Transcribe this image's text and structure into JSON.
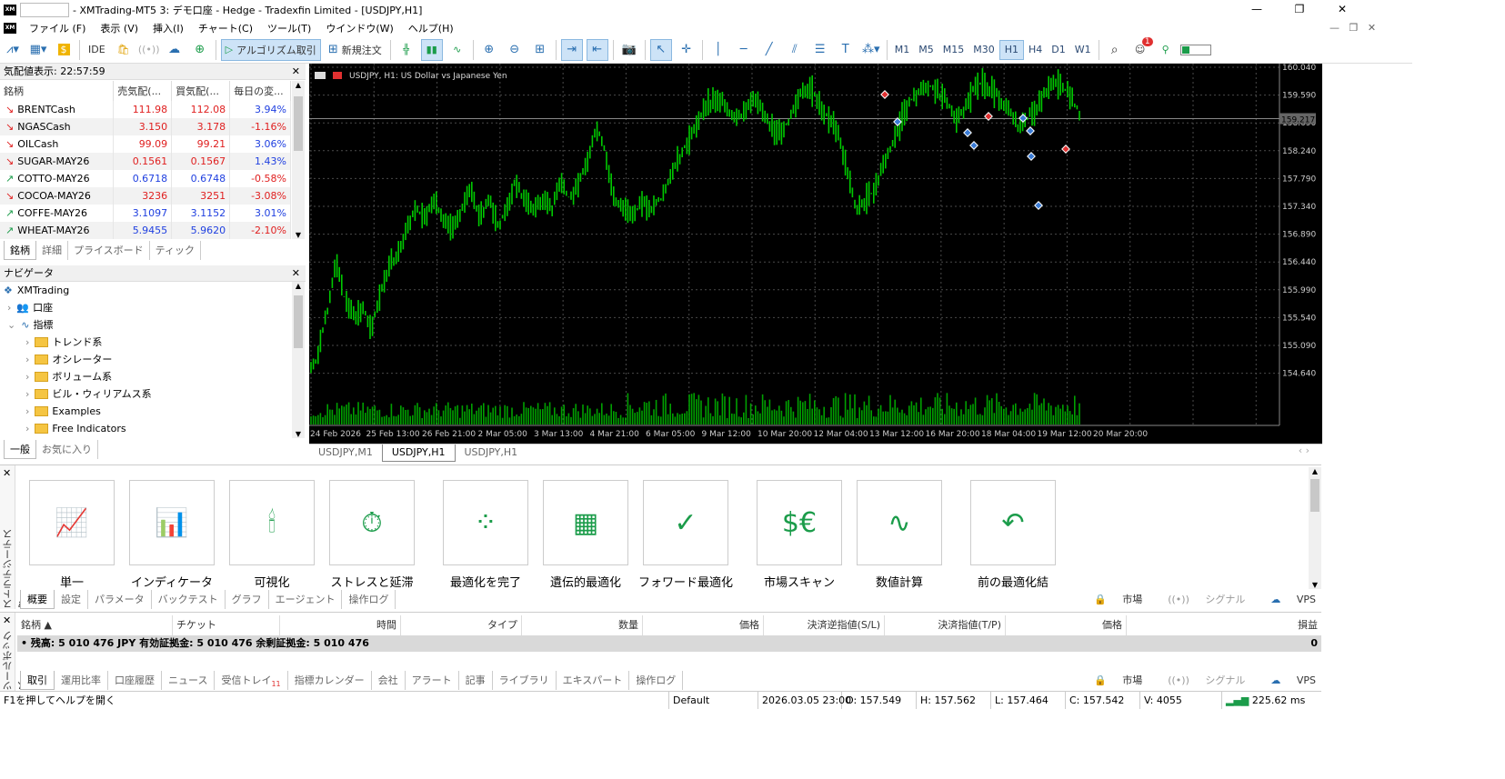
{
  "titlebar": {
    "title": "- XMTrading-MT5 3: デモ口座 - Hedge - Tradexfin Limited - [USDJPY,H1]",
    "minimize": "—",
    "maximize": "❐",
    "close": "✕"
  },
  "menu": [
    "ファイル (F)",
    "表示 (V)",
    "挿入(I)",
    "チャート(C)",
    "ツール(T)",
    "ウインドウ(W)",
    "ヘルプ(H)"
  ],
  "toolbar": {
    "ide": "IDE",
    "algo": "アルゴリズム取引",
    "new_order": "新規注文",
    "timeframes": [
      "M1",
      "M5",
      "M15",
      "M30",
      "H1",
      "H4",
      "D1",
      "W1"
    ],
    "active_tf": "H1",
    "notify_count": "1"
  },
  "market_watch": {
    "title": "気配値表示: 22:57:59",
    "headers": [
      "銘柄",
      "売気配(...",
      "買気配(...",
      "毎日の変..."
    ],
    "rows": [
      {
        "symbol": "BRENTCash",
        "dir": "down",
        "bid": "111.98",
        "ask": "112.08",
        "change": "3.94%",
        "color": "red",
        "chg_color": "blue"
      },
      {
        "symbol": "NGASCash",
        "dir": "down",
        "bid": "3.150",
        "ask": "3.178",
        "change": "-1.16%",
        "color": "red",
        "chg_color": "red"
      },
      {
        "symbol": "OILCash",
        "dir": "down",
        "bid": "99.09",
        "ask": "99.21",
        "change": "3.06%",
        "color": "red",
        "chg_color": "blue"
      },
      {
        "symbol": "SUGAR-MAY26",
        "dir": "down",
        "bid": "0.1561",
        "ask": "0.1567",
        "change": "1.43%",
        "color": "red",
        "chg_color": "blue"
      },
      {
        "symbol": "COTTO-MAY26",
        "dir": "up",
        "bid": "0.6718",
        "ask": "0.6748",
        "change": "-0.58%",
        "color": "blue",
        "chg_color": "red"
      },
      {
        "symbol": "COCOA-MAY26",
        "dir": "down",
        "bid": "3236",
        "ask": "3251",
        "change": "-3.08%",
        "color": "red",
        "chg_color": "red"
      },
      {
        "symbol": "COFFE-MAY26",
        "dir": "up",
        "bid": "3.1097",
        "ask": "3.1152",
        "change": "3.01%",
        "color": "blue",
        "chg_color": "blue"
      },
      {
        "symbol": "WHEAT-MAY26",
        "dir": "up",
        "bid": "5.9455",
        "ask": "5.9620",
        "change": "-2.10%",
        "color": "blue",
        "chg_color": "red"
      }
    ],
    "tabs": [
      "銘柄",
      "詳細",
      "プライスボード",
      "ティック"
    ]
  },
  "navigator": {
    "title": "ナビゲータ",
    "root": "XMTrading",
    "items": [
      "口座",
      "指標"
    ],
    "folders": [
      "トレンド系",
      "オシレーター",
      "ボリューム系",
      "ビル・ウィリアムス系",
      "Examples",
      "Free Indicators"
    ],
    "tabs": [
      "一般",
      "お気に入り"
    ]
  },
  "chart": {
    "header": "USDJPY, H1:  US Dollar vs Japanese Yen",
    "price_labels": [
      "160.040",
      "159.590",
      "158.690",
      "158.240",
      "157.790",
      "157.340",
      "156.890",
      "156.440",
      "155.990",
      "155.540",
      "155.090",
      "154.640"
    ],
    "current_price": "159.217",
    "time_labels": [
      "24 Feb 2026",
      "25 Feb 13:00",
      "26 Feb 21:00",
      "2 Mar 05:00",
      "3 Mar 13:00",
      "4 Mar 21:00",
      "6 Mar 05:00",
      "9 Mar 12:00",
      "10 Mar 20:00",
      "12 Mar 04:00",
      "13 Mar 12:00",
      "16 Mar 20:00",
      "18 Mar 04:00",
      "19 Mar 12:00",
      "20 Mar 20:00"
    ],
    "tabs": [
      "USDJPY,M1",
      "USDJPY,H1",
      "USDJPY,H1"
    ],
    "active_tab": 1,
    "colors": {
      "bg": "#000000",
      "grid": "#4a4a4a",
      "bars": "#00c800",
      "volume": "#00a000"
    }
  },
  "tester": {
    "side_label": "ストラテジーテスター",
    "modes": [
      "単一",
      "インディケータ",
      "可視化",
      "ストレスと延滞",
      "最適化を完了",
      "遺伝的最適化",
      "フォワード最適化",
      "市場スキャン",
      "数値計算",
      "前の最適化結"
    ],
    "tabs": [
      "概要",
      "設定",
      "パラメータ",
      "バックテスト",
      "グラフ",
      "エージェント",
      "操作ログ"
    ],
    "right": [
      "市場",
      "シグナル",
      "VPS"
    ]
  },
  "toolbox": {
    "side_label": "ツールボックス",
    "headers": [
      "銘柄",
      "チケット",
      "時間",
      "タイプ",
      "数量",
      "価格",
      "決済逆指値(S/L)",
      "決済指値(T/P)",
      "価格",
      "損益"
    ],
    "balance_row": "残高: 5 010 476 JPY  有効証拠金: 5 010 476  余剰証拠金: 5 010 476",
    "balance_value": "0",
    "tabs": [
      "取引",
      "運用比率",
      "口座履歴",
      "ニュース",
      "受信トレイ",
      "指標カレンダー",
      "会社",
      "アラート",
      "記事",
      "ライブラリ",
      "エキスパート",
      "操作ログ"
    ],
    "inbox_count": "11",
    "right": [
      "市場",
      "シグナル",
      "VPS"
    ]
  },
  "statusbar": {
    "help": "F1を押してヘルプを開く",
    "profile": "Default",
    "datetime": "2026.03.05 23:00",
    "open": "O: 157.549",
    "high": "H: 157.562",
    "low": "L: 157.464",
    "close": "C: 157.542",
    "volume": "V: 4055",
    "ping": "225.62 ms"
  }
}
